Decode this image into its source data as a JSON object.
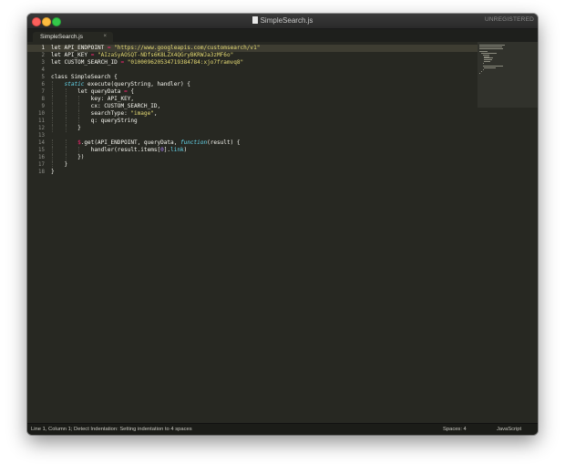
{
  "window": {
    "title": "SimpleSearch.js",
    "registration": "UNREGISTERED"
  },
  "tabs": [
    {
      "label": "SimpleSearch.js",
      "close": "×"
    }
  ],
  "editor": {
    "current_line": 1,
    "line_numbers": [
      "1",
      "2",
      "3",
      "4",
      "5",
      "6",
      "7",
      "8",
      "9",
      "10",
      "11",
      "12",
      "13",
      "14",
      "15",
      "16",
      "17",
      "18"
    ],
    "lines": [
      "let API_ENDPOINT = \"https://www.googleapis.com/customsearch/v1\"",
      "let API_KEY = \"AIzaSyAOSQT-NDfs6K8LZX4QGryBKRWJa3zMF6o\"",
      "let CUSTOM_SEARCH_ID = \"010009620534719384784:xjo7framvq8\"",
      "",
      "class SimpleSearch {",
      "    static execute(queryString, handler) {",
      "        let queryData = {",
      "            key: API_KEY,",
      "            cx: CUSTOM_SEARCH_ID,",
      "            searchType: \"image\",",
      "            q: queryString",
      "        }",
      "",
      "        $.get(API_ENDPOINT, queryData, function(result) {",
      "            handler(result.items[0].link)",
      "        })",
      "    }",
      "}"
    ]
  },
  "status": {
    "left": "Line 1, Column 1; Detect Indentation: Setting indentation to 4 spaces",
    "spaces": "Spaces: 4",
    "syntax": "JavaScript"
  },
  "colors": {
    "background": "#272822",
    "keyword": "#66d9ef",
    "string": "#e6db74",
    "number": "#ae81ff",
    "operator": "#f92672",
    "function": "#a6e22e",
    "text": "#f8f8f2"
  }
}
